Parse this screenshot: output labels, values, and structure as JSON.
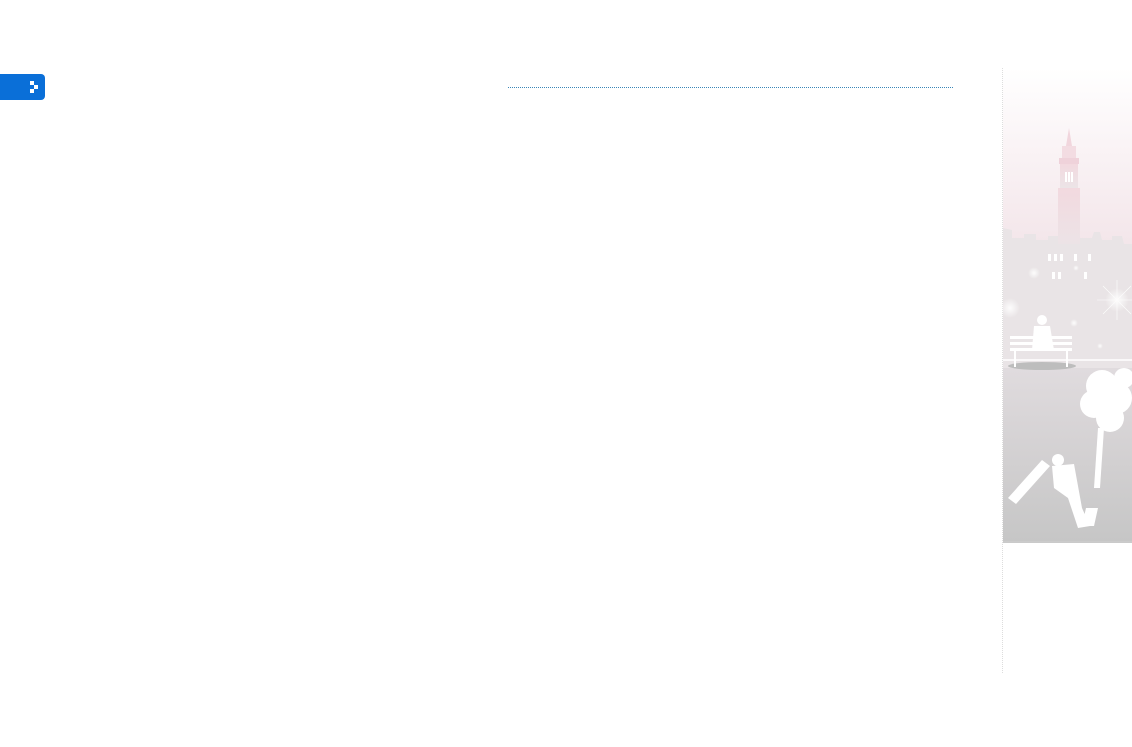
{
  "theme": {
    "accent": "#0a6fd8",
    "rule_color": "#3a86b8",
    "illustration_top": "#f3e6ea",
    "illustration_bottom": "#c9c9c9"
  },
  "illustration": {
    "subject": "city-square-illustration"
  }
}
